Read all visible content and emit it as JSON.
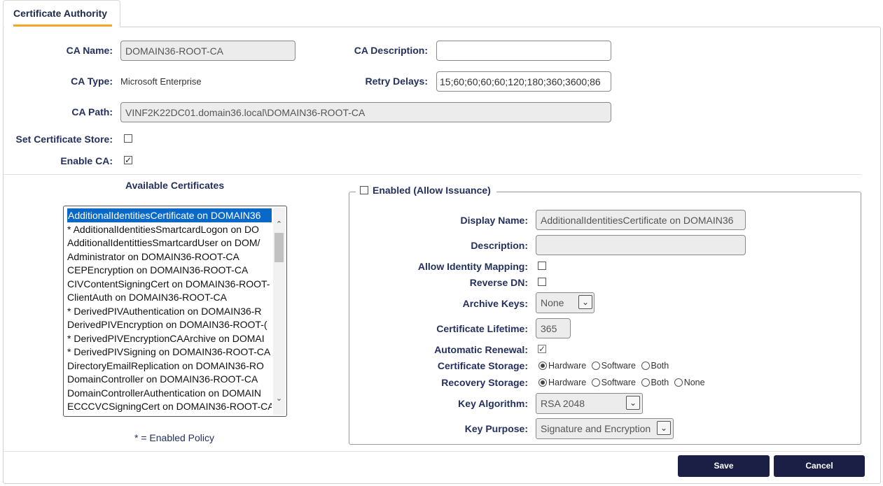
{
  "tab": {
    "label": "Certificate Authority"
  },
  "ca": {
    "name_label": "CA Name:",
    "name_value": "DOMAIN36-ROOT-CA",
    "description_label": "CA Description:",
    "description_value": "",
    "type_label": "CA Type:",
    "type_value": "Microsoft Enterprise",
    "retry_label": "Retry Delays:",
    "retry_value": "15;60;60;60;60;120;180;360;3600;86",
    "path_label": "CA Path:",
    "path_value": "VINF2K22DC01.domain36.local\\DOMAIN36-ROOT-CA",
    "cert_store_label": "Set Certificate Store:",
    "cert_store_checked": false,
    "enable_label": "Enable CA:",
    "enable_checked": true
  },
  "certificates": {
    "title": "Available Certificates",
    "items": [
      "AdditionalIdentitiesCertificate on DOMAIN36",
      "* AdditionalIdentitiesSmartcardLogon on DO",
      "AdditionalIdentittiesSmartcardUser on DOM/",
      "Administrator on DOMAIN36-ROOT-CA",
      "CEPEncryption on DOMAIN36-ROOT-CA",
      "CIVContentSigningCert on DOMAIN36-ROOT-",
      "ClientAuth on DOMAIN36-ROOT-CA",
      "* DerivedPIVAuthentication on DOMAIN36-R",
      "DerivedPIVEncryption on DOMAIN36-ROOT-(",
      "* DerivedPIVEncryptionCAArchive on DOMAI",
      "* DerivedPIVSigning on DOMAIN36-ROOT-CA",
      "DirectoryEmailReplication on DOMAIN36-RO",
      "DomainController on DOMAIN36-ROOT-CA",
      "DomainControllerAuthentication on DOMAIN",
      "ECCCVCSigningCert on DOMAIN36-ROOT-CA"
    ],
    "selected_index": 0,
    "footnote": "* = Enabled Policy"
  },
  "detail": {
    "enabled_label": "Enabled (Allow Issuance)",
    "enabled_checked": false,
    "display_name_label": "Display Name:",
    "display_name_value": "AdditionalIdentitiesCertificate on DOMAIN36",
    "description_label": "Description:",
    "description_value": "",
    "identity_mapping_label": "Allow Identity Mapping:",
    "reverse_dn_label": "Reverse DN:",
    "archive_keys_label": "Archive Keys:",
    "archive_keys_value": "None",
    "lifetime_label": "Certificate Lifetime:",
    "lifetime_value": "365",
    "auto_renewal_label": "Automatic Renewal:",
    "cert_storage_label": "Certificate Storage:",
    "recovery_storage_label": "Recovery Storage:",
    "opt_hardware": "Hardware",
    "opt_software": "Software",
    "opt_both": "Both",
    "opt_none": "None",
    "key_algorithm_label": "Key Algorithm:",
    "key_algorithm_value": "RSA 2048",
    "key_purpose_label": "Key Purpose:",
    "key_purpose_value": "Signature and Encryption"
  },
  "buttons": {
    "save": "Save",
    "cancel": "Cancel"
  },
  "icons": {
    "checkmark": "check-icon",
    "dropdown": "chevron-down-icon"
  }
}
